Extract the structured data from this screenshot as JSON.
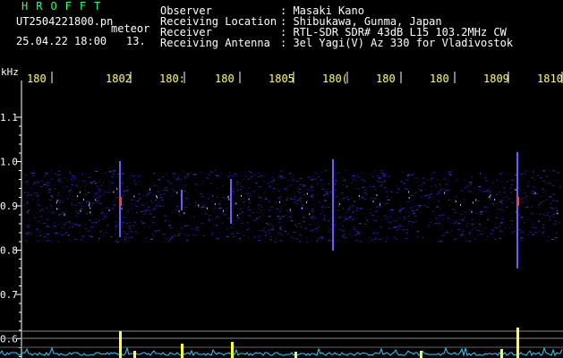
{
  "header": {
    "title": "HROFFT",
    "filename": "UT2504221800.pn",
    "meteor_label": "meteor",
    "datetime": "25.04.22 18:00",
    "count": "13.",
    "info": [
      {
        "label": "Observer",
        "value": ": Masaki Kano"
      },
      {
        "label": "Receiving Location",
        "value": ": Shibukawa, Gunma, Japan"
      },
      {
        "label": "Receiver",
        "value": ": RTL-SDR SDR# 43dB L15 103.2MHz CW"
      },
      {
        "label": "Receiving Antenna",
        "value": ": 3el Yagi(V) Az 330 for Vladivostok"
      }
    ]
  },
  "spectrogram": {
    "y_unit": "kHz",
    "y_ticks": [
      "1.1",
      "1.0",
      "0.9",
      "0.8",
      "0.7",
      "0.6"
    ],
    "y_tick_values": [
      1.1,
      1.0,
      0.9,
      0.8,
      0.7,
      0.6
    ],
    "time_ticks": [
      "180",
      "1802",
      "180:",
      "180",
      "1805",
      "180(",
      "180",
      "180",
      "1809",
      "1810"
    ],
    "colors": {
      "background": "#000000",
      "text": "#ffffff",
      "tick_label": "#ffff66",
      "title": "#33ff66",
      "noise": "#2a1aa0",
      "signal": "#ffff33",
      "baseline": "#33ccff"
    }
  }
}
